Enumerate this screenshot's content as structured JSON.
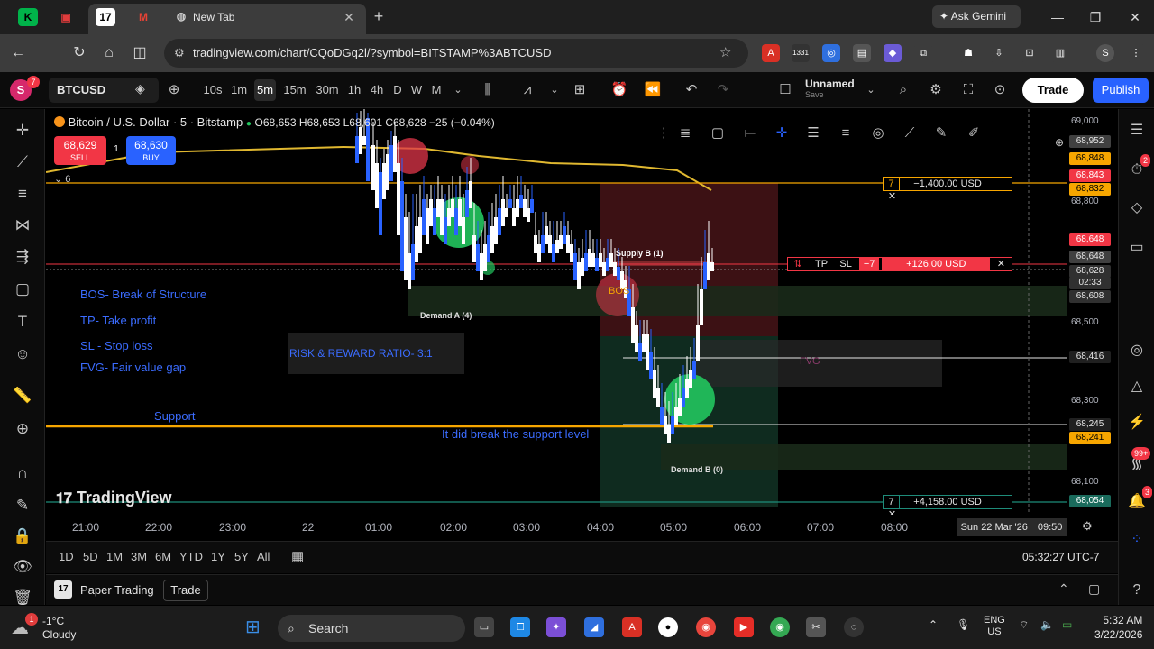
{
  "browser": {
    "tab_title": "New Tab",
    "ask_gemini": "Ask Gemini",
    "url": "tradingview.com/chart/CQoDGq2l/?symbol=BITSTAMP%3ABTCUSD",
    "ext_badge": "1331"
  },
  "header": {
    "avatar": "S",
    "avatar_badge": "7",
    "symbol": "BTCUSD",
    "intervals": [
      "10s",
      "1m",
      "5m",
      "15m",
      "30m",
      "1h",
      "4h",
      "D",
      "W",
      "M"
    ],
    "selected_interval": "5m",
    "layout_name": "Unnamed",
    "layout_sub": "Save",
    "trade": "Trade",
    "publish": "Publish"
  },
  "legend": {
    "title": "Bitcoin / U.S. Dollar · 5 · Bitstamp",
    "ohlc": "O68,653  H68,653  L68,601  C68,628  −25 (−0.04%)"
  },
  "quick_trade": {
    "sell_price": "68,629",
    "sell_label": "SELL",
    "buy_price": "68,630",
    "buy_label": "BUY",
    "spread": "1",
    "collapse": "6"
  },
  "notes": {
    "bos": "BOS- Break of Structure",
    "tp": "TP- Take profit",
    "sl": "SL - Stop loss",
    "fvg": "FVG- Fair value gap",
    "rr": "RISK & REWARD RATIO- 3:1",
    "support": "Support",
    "break_note": "It did break the support level",
    "demand_a": "Demand A (4)",
    "demand_b": "Demand B (0)",
    "supply_b": "Supply B (1)",
    "bos_tag": "BOS",
    "fvg_tag": "FVG"
  },
  "positions": {
    "top_qty": "7",
    "top_pl": "−1,400.00 USD",
    "mid_tp": "TP",
    "mid_sl": "SL",
    "mid_qty": "−7",
    "mid_pl": "+126.00 USD",
    "bot_qty": "7",
    "bot_pl": "+4,158.00 USD"
  },
  "price_axis": {
    "ticks": [
      "69,000",
      "68,800",
      "68,500",
      "68,300",
      "68,100"
    ],
    "tags": [
      {
        "t": "68,952",
        "c": "#404040",
        "fg": "#e6e6e6"
      },
      {
        "t": "68,848",
        "c": "#f7a600",
        "fg": "#000"
      },
      {
        "t": "68,843",
        "c": "#f23645",
        "fg": "#fff"
      },
      {
        "t": "68,832",
        "c": "#f7a600",
        "fg": "#000"
      },
      {
        "t": "68,648",
        "c": "#f23645",
        "fg": "#fff"
      },
      {
        "t": "68,648",
        "c": "#404040",
        "fg": "#e6e6e6"
      },
      {
        "t": "68,628",
        "c": "#303030",
        "fg": "#e6e6e6"
      },
      {
        "t": "02:33",
        "c": "#303030",
        "fg": "#e6e6e6"
      },
      {
        "t": "68,608",
        "c": "#303030",
        "fg": "#e6e6e6"
      },
      {
        "t": "68,416",
        "c": "#202020",
        "fg": "#e6e6e6"
      },
      {
        "t": "68,245",
        "c": "#202020",
        "fg": "#e6e6e6"
      },
      {
        "t": "68,241",
        "c": "#f7a600",
        "fg": "#000"
      },
      {
        "t": "68,054",
        "c": "#1a6b5c",
        "fg": "#fff"
      }
    ]
  },
  "time_axis": {
    "labels": [
      "21:00",
      "22:00",
      "23:00",
      "22",
      "01:00",
      "02:00",
      "03:00",
      "04:00",
      "05:00",
      "06:00",
      "07:00",
      "08:00"
    ],
    "cursor_date": "Sun 22 Mar '26",
    "cursor_time": "09:50"
  },
  "range_bar": {
    "ranges": [
      "1D",
      "5D",
      "1M",
      "3M",
      "6M",
      "YTD",
      "1Y",
      "5Y",
      "All"
    ],
    "clock": "05:32:27 UTC-7"
  },
  "paper": {
    "label": "Paper Trading",
    "trade": "Trade"
  },
  "watermark": "TradingView",
  "taskbar": {
    "temp": "-1°C",
    "cond": "Cloudy",
    "weather_badge": "1",
    "search": "Search",
    "lang1": "ENG",
    "lang2": "US",
    "time": "5:32 AM",
    "date": "3/22/2026"
  },
  "right_badges": {
    "alerts": "2",
    "chat": "99+",
    "notif": "3"
  },
  "colors": {
    "sell": "#f23645",
    "buy": "#2962ff",
    "accent_orange": "#f7a600",
    "bull": "#2962ff",
    "bear": "#ffffff"
  }
}
